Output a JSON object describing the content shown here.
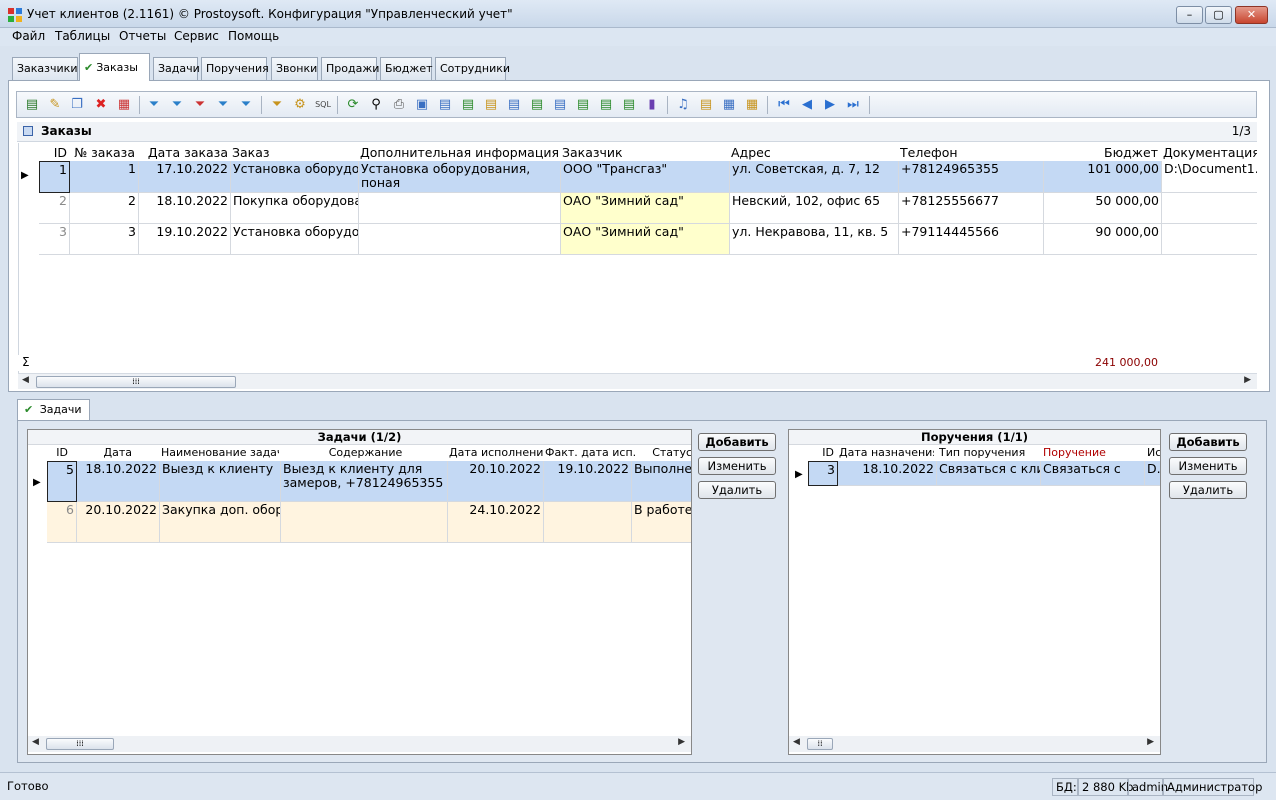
{
  "window": {
    "title": "Учет клиентов (2.1161) © Prostoysoft. Конфигурация \"Управленческий учет\"",
    "controls": [
      "–",
      "▢",
      "✕"
    ]
  },
  "menu": [
    "Файл",
    "Таблицы",
    "Отчеты",
    "Сервис",
    "Помощь"
  ],
  "main_tabs": [
    "Заказчики",
    "Заказы",
    "Задачи",
    "Поручения",
    "Звонки",
    "Продажи",
    "Бюджет",
    "Сотрудники"
  ],
  "active_tab": "Заказы",
  "orders": {
    "title": "Заказы",
    "counter": "1/3",
    "columns": [
      "ID",
      "№ заказа",
      "Дата заказа",
      "Заказ",
      "Дополнительная информация",
      "Заказчик",
      "Адрес",
      "Телефон",
      "Бюджет",
      "Документация"
    ],
    "rows": [
      {
        "id": "1",
        "num": "1",
        "date": "17.10.2022",
        "order": "Установка оборудо",
        "info": "Установка оборудования, поная",
        "customer": "ООО \"Трансгаз\"",
        "address": "ул. Советская, д. 7, 12",
        "phone": "+78124965355",
        "budget": "101 000,00",
        "docs": "D:\\Document1."
      },
      {
        "id": "2",
        "num": "2",
        "date": "18.10.2022",
        "order": "Покупка оборудова",
        "info": "",
        "customer": "ОАО \"Зимний сад\"",
        "address": "Невский, 102, офис 65",
        "phone": "+78125556677",
        "budget": "50 000,00",
        "docs": ""
      },
      {
        "id": "3",
        "num": "3",
        "date": "19.10.2022",
        "order": "Установка оборудо",
        "info": "",
        "customer": "ОАО \"Зимний сад\"",
        "address": "ул. Некравова, 11, кв. 5",
        "phone": "+79114445566",
        "budget": "90 000,00",
        "docs": ""
      }
    ],
    "sum_symbol": "Σ",
    "sum_budget": "241 000,00"
  },
  "bottom_tab": "Задачи",
  "tasks": {
    "title": "Задачи (1/2)",
    "columns": [
      "ID",
      "Дата",
      "Наименование задачи",
      "Содержание",
      "Дата исполнения",
      "Факт. дата исп.",
      "Статус"
    ],
    "rows": [
      {
        "id": "5",
        "date": "18.10.2022",
        "name": "Выезд к клиенту",
        "content": "Выезд к клиенту для замеров, +78124965355",
        "due": "20.10.2022",
        "fact": "19.10.2022",
        "status": "Выполне"
      },
      {
        "id": "6",
        "date": "20.10.2022",
        "name": "Закупка доп. обор",
        "content": "",
        "due": "24.10.2022",
        "fact": "",
        "status": "В работе"
      }
    ],
    "buttons": {
      "add": "Добавить",
      "edit": "Изменить",
      "delete": "Удалить"
    }
  },
  "assignments": {
    "title": "Поручения (1/1)",
    "columns": [
      "ID",
      "Дата назначения",
      "Тип поручения",
      "Поручение",
      "Ис"
    ],
    "rows": [
      {
        "id": "3",
        "date": "18.10.2022",
        "type": "Связаться с клие",
        "text": "Связаться с",
        "extra": "D."
      }
    ],
    "buttons": {
      "add": "Добавить",
      "edit": "Изменить",
      "delete": "Удалить"
    }
  },
  "status_bar": {
    "state": "Готово",
    "db_label": "БД:",
    "db_size": "2 880 Kb",
    "user": "admin",
    "role": "Администратор"
  },
  "colors": {
    "selected_row": "#c4d9f4",
    "customer_highlight": "#ffffcc",
    "task_row2": "#fff4e0",
    "sum_text": "#8b0000",
    "assignment_header_red": "#b00000"
  }
}
